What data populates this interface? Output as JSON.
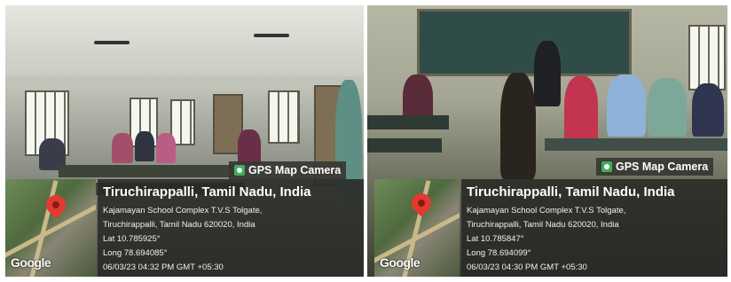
{
  "photos": [
    {
      "badge": "GPS Map Camera",
      "title": "Tiruchirappalli, Tamil Nadu, India",
      "address1": "Kajamayan School Complex T.V.S Tolgate,",
      "address2": "Tiruchirappalli, Tamil Nadu 620020, India",
      "lat": "Lat 10.785925°",
      "long": "Long 78.694085°",
      "datetime": "06/03/23 04:32 PM GMT +05:30",
      "map_brand": "Google",
      "icons": [
        "camera-pin-icon",
        "map-pin-icon"
      ]
    },
    {
      "badge": "GPS Map Camera",
      "title": "Tiruchirappalli, Tamil Nadu, India",
      "address1": "Kajamayan School Complex T.V.S Tolgate,",
      "address2": "Tiruchirappalli, Tamil Nadu 620020, India",
      "lat": "Lat 10.785847°",
      "long": "Long 78.694099°",
      "datetime": "06/03/23 04:30 PM GMT +05:30",
      "map_brand": "Google",
      "icons": [
        "camera-pin-icon",
        "map-pin-icon"
      ]
    }
  ],
  "colors": {
    "overlay": "#28281f",
    "pin": "#e33a2f",
    "badge_icon": "#3fae5a"
  }
}
